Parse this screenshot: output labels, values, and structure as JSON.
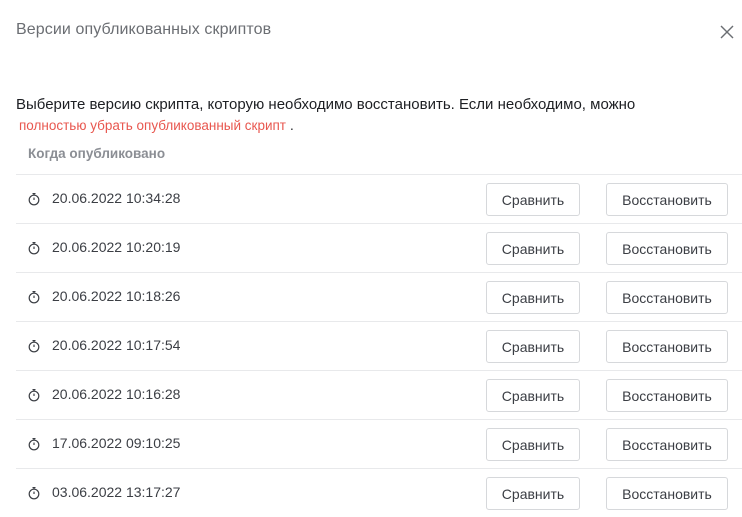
{
  "dialog": {
    "title": "Версии опубликованных скриптов",
    "close_icon": "close-icon"
  },
  "description": {
    "text": "Выберите версию скрипта, которую необходимо восстановить. Если необходимо, можно",
    "link": "полностью убрать опубликованный скрипт",
    "suffix": "."
  },
  "table": {
    "column_header": "Когда опубликовано",
    "row_icon": "stopwatch-icon",
    "compare_label": "Сравнить",
    "restore_label": "Восстановить",
    "rows": [
      {
        "date": "20.06.2022 10:34:28",
        "compare": "Сравнить",
        "restore": "Восстановить"
      },
      {
        "date": "20.06.2022 10:20:19",
        "compare": "Сравнить",
        "restore": "Восстановить"
      },
      {
        "date": "20.06.2022 10:18:26",
        "compare": "Сравнить",
        "restore": "Восстановить"
      },
      {
        "date": "20.06.2022 10:17:54",
        "compare": "Сравнить",
        "restore": "Восстановить"
      },
      {
        "date": "20.06.2022 10:16:28",
        "compare": "Сравнить",
        "restore": "Восстановить"
      },
      {
        "date": "17.06.2022 09:10:25",
        "compare": "Сравнить",
        "restore": "Восстановить"
      },
      {
        "date": "03.06.2022 13:17:27",
        "compare": "Сравнить",
        "restore": "Восстановить"
      }
    ]
  },
  "colors": {
    "link": "#e8574f",
    "text": "#1d1f23",
    "muted": "#6b6e73",
    "border": "#d6d8db"
  }
}
